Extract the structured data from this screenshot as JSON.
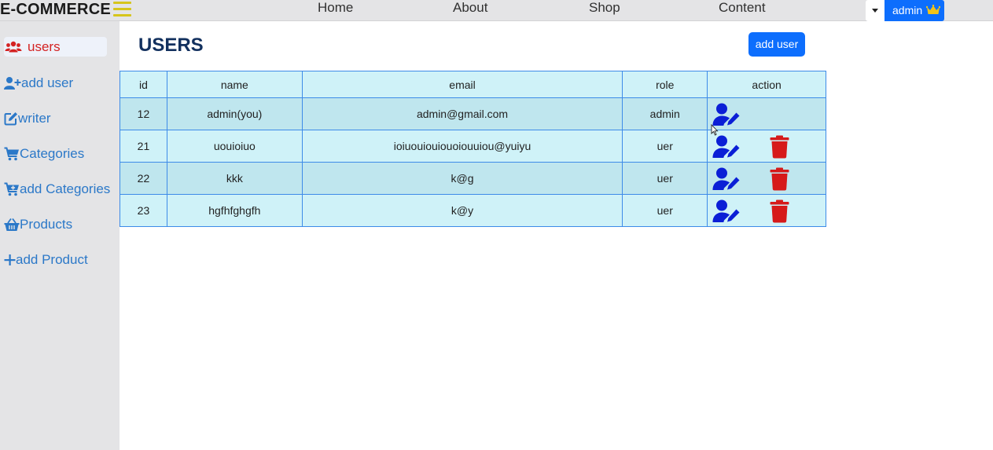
{
  "navbar": {
    "brand": "E-COMMERCE",
    "links": [
      "Home",
      "About",
      "Shop",
      "Content"
    ],
    "user_button": "admin"
  },
  "sidebar": {
    "items": [
      {
        "label": "users",
        "icon": "users-icon",
        "active": true
      },
      {
        "label": "add user",
        "icon": "user-plus-icon"
      },
      {
        "label": "writer",
        "icon": "pen-square-icon"
      },
      {
        "label": "Categories",
        "icon": "cart-icon"
      },
      {
        "label": "add Categories",
        "icon": "cart-plus-icon"
      },
      {
        "label": "Products",
        "icon": "basket-icon"
      },
      {
        "label": "add Product",
        "icon": "plus-icon"
      }
    ]
  },
  "main": {
    "title": "USERS",
    "add_button": "add user",
    "table": {
      "headers": [
        "id",
        "name",
        "email",
        "role",
        "action"
      ],
      "rows": [
        {
          "id": "12",
          "name": "admin(you)",
          "email": "admin@gmail.com",
          "role": "admin",
          "deletable": false
        },
        {
          "id": "21",
          "name": "uouioiuo",
          "email": "ioiuouiouiouoiouuiou@yuiyu",
          "role": "uer",
          "deletable": true
        },
        {
          "id": "22",
          "name": "kkk",
          "email": "k@g",
          "role": "uer",
          "deletable": true
        },
        {
          "id": "23",
          "name": "hgfhfghgfh",
          "email": "k@y",
          "role": "uer",
          "deletable": true
        }
      ]
    }
  },
  "colors": {
    "accent": "#0d6efd",
    "edit_icon": "#0b1fd6",
    "delete_icon": "#d61a1a",
    "active_sidebar": "#d42222",
    "sidebar_link": "#2b78c8",
    "title": "#12305e",
    "table_border": "#3d8be8"
  }
}
